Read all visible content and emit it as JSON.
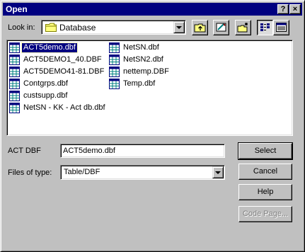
{
  "window": {
    "title": "Open",
    "help_label": "?",
    "close_label": "×"
  },
  "lookin": {
    "label": "Look in:",
    "value": "Database"
  },
  "files": [
    {
      "name": "ACT5demo.dbf",
      "selected": true
    },
    {
      "name": "ACT5DEMO1_40.DBF",
      "selected": false
    },
    {
      "name": "ACT5DEMO41-81.DBF",
      "selected": false
    },
    {
      "name": "Contgrps.dbf",
      "selected": false
    },
    {
      "name": "custsupp.dbf",
      "selected": false
    },
    {
      "name": "NetSN - KK - Act db.dbf",
      "selected": false
    },
    {
      "name": "NetSN.dbf",
      "selected": false
    },
    {
      "name": "NetSN2.dbf",
      "selected": false
    },
    {
      "name": "nettemp.DBF",
      "selected": false
    },
    {
      "name": "Temp.dbf",
      "selected": false
    }
  ],
  "filename": {
    "label": "ACT DBF",
    "value": "ACT5demo.dbf"
  },
  "filetype": {
    "label": "Files of type:",
    "value": "Table/DBF"
  },
  "buttons": {
    "select": "Select",
    "cancel": "Cancel",
    "help": "Help",
    "code_page": "Code Page..."
  },
  "colors": {
    "titlebar": "#000080",
    "face": "#c0c0c0",
    "selection": "#000080"
  }
}
